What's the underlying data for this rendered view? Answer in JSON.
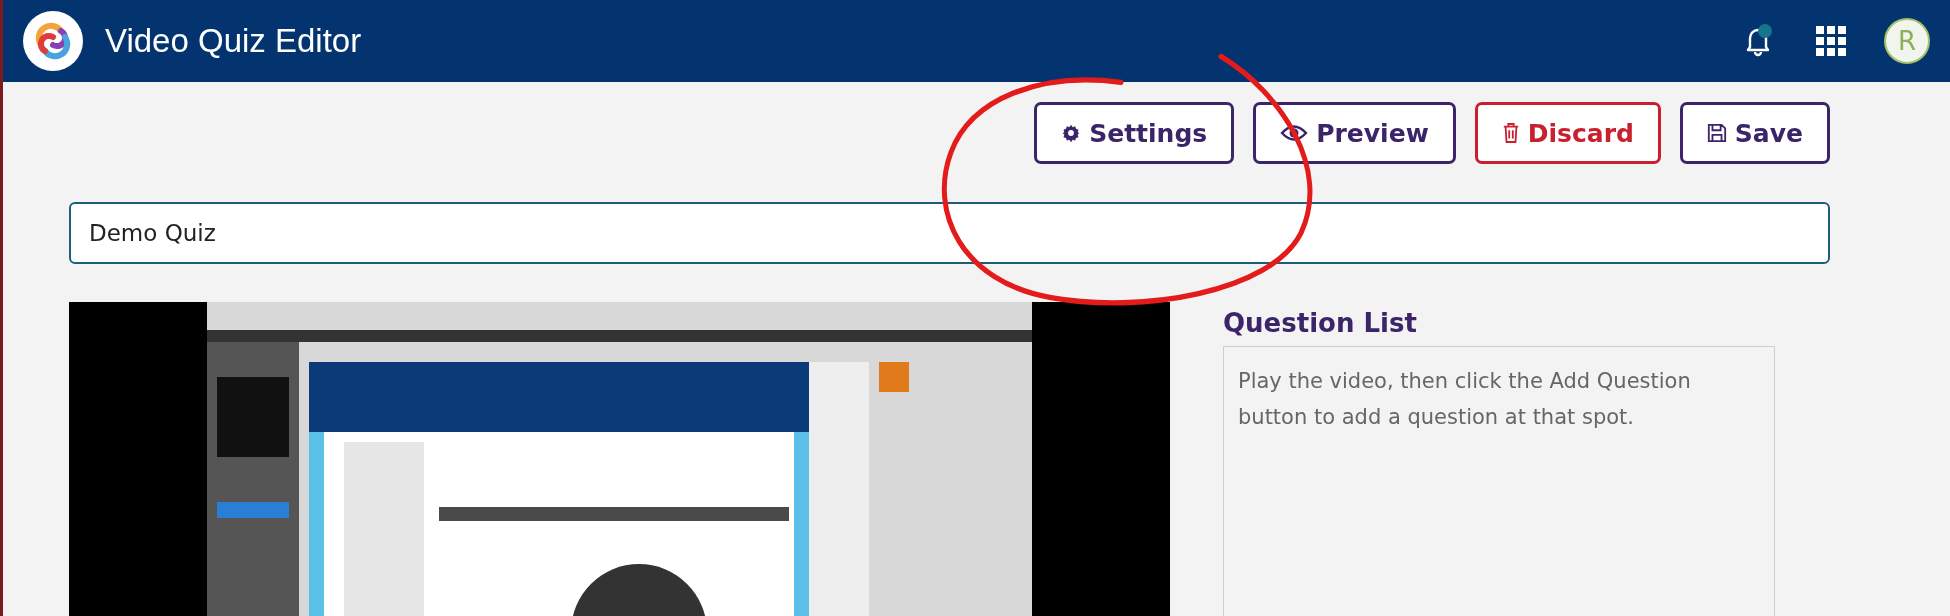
{
  "header": {
    "title": "Video Quiz Editor",
    "notifications": {
      "unread": true
    },
    "avatar": {
      "initial": "R"
    }
  },
  "actions": [
    {
      "label": "Settings",
      "kind": "settings"
    },
    {
      "label": "Preview",
      "kind": "preview"
    },
    {
      "label": "Discard",
      "kind": "discard"
    },
    {
      "label": "Save",
      "kind": "save"
    }
  ],
  "quiz_title": {
    "value": "Demo Quiz"
  },
  "question_list": {
    "heading": "Question List",
    "empty_message": "Play the video, then click the Add Question button to add a question at that spot."
  },
  "annotation": {
    "kind": "circle"
  }
}
